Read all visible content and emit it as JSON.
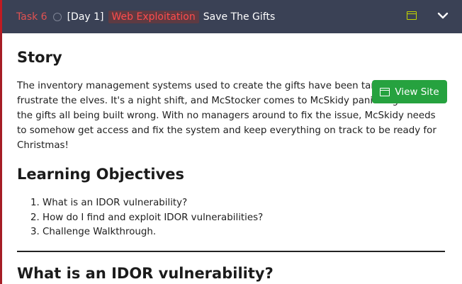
{
  "task": {
    "number": "Task 6",
    "day": "[Day 1]",
    "category": "Web Exploitation",
    "title": "Save The Gifts"
  },
  "buttons": {
    "view_site": "View Site"
  },
  "icons": {
    "window": "window-icon",
    "chevron": "chevron-down-icon",
    "status": "circle-icon"
  },
  "colors": {
    "header_bg": "#3a4155",
    "accent_red": "#c01b22",
    "category_text": "#ff4c4c",
    "button_green": "#26a23f",
    "window_icon": "#c4d600"
  },
  "story": {
    "heading": "Story",
    "text": "The inventory management systems used to create the gifts have been tampered with to frustrate the elves. It's a night shift, and McStocker comes to McSkidy panicking about the gifts all being built wrong. With no managers around to fix the issue, McSkidy needs to somehow get access and fix the system and keep everything on track to be ready for Christmas!"
  },
  "objectives": {
    "heading": "Learning Objectives",
    "items": [
      "What is an IDOR vulnerability?",
      "How do I find and exploit IDOR vulnerabilities?",
      "Challenge Walkthrough."
    ]
  },
  "next_section": {
    "heading": "What is an IDOR vulnerability?"
  }
}
